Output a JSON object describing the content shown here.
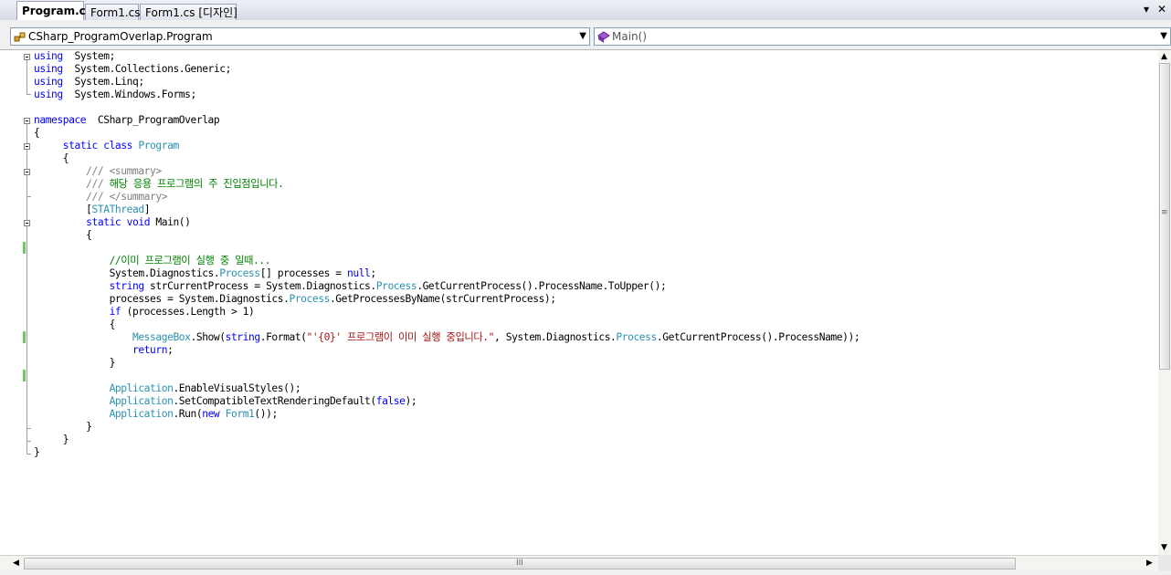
{
  "tabs": [
    {
      "label": "Program.cs",
      "active": true
    },
    {
      "label": "Form1.cs",
      "active": false
    },
    {
      "label": "Form1.cs [디자인]",
      "active": false
    }
  ],
  "tab_controls": {
    "dropdown_glyph": "▾",
    "close_glyph": "✕"
  },
  "nav": {
    "class_combo": {
      "value": "CSharp_ProgramOverlap.Program",
      "icon": "class-icon"
    },
    "member_combo": {
      "value": "Main()",
      "icon": "method-icon"
    },
    "dropdown_glyph": "▼"
  },
  "code_lines": [
    [
      [
        "kw",
        "using"
      ],
      [
        "",
        "  System;"
      ]
    ],
    [
      [
        "kw",
        "using"
      ],
      [
        "",
        "  System.Collections.Generic;"
      ]
    ],
    [
      [
        "kw",
        "using"
      ],
      [
        "",
        "  System.Linq;"
      ]
    ],
    [
      [
        "kw",
        "using"
      ],
      [
        "",
        "  System.Windows.Forms;"
      ]
    ],
    [],
    [
      [
        "kw",
        "namespace"
      ],
      [
        "",
        "  CSharp_ProgramOverlap"
      ]
    ],
    [
      [
        "",
        "{"
      ]
    ],
    [
      [
        "",
        "     "
      ],
      [
        "kw",
        "static"
      ],
      [
        "",
        " "
      ],
      [
        "kw",
        "class"
      ],
      [
        "",
        " "
      ],
      [
        "ty",
        "Program"
      ]
    ],
    [
      [
        "",
        "     {"
      ]
    ],
    [
      [
        "",
        "         "
      ],
      [
        "dc",
        "/// <summary>"
      ]
    ],
    [
      [
        "",
        "         "
      ],
      [
        "dc",
        "/// "
      ],
      [
        "cm",
        "해당 응용 프로그램의 주 진입점입니다."
      ]
    ],
    [
      [
        "",
        "         "
      ],
      [
        "dc",
        "/// </summary>"
      ]
    ],
    [
      [
        "",
        "         ["
      ],
      [
        "ty",
        "STAThread"
      ],
      [
        "",
        "]"
      ]
    ],
    [
      [
        "",
        "         "
      ],
      [
        "kw",
        "static"
      ],
      [
        "",
        " "
      ],
      [
        "kw",
        "void"
      ],
      [
        "",
        " Main()"
      ]
    ],
    [
      [
        "",
        "         {"
      ]
    ],
    [],
    [
      [
        "",
        "             "
      ],
      [
        "cm",
        "//이미 프로그램이 실행 중 일때..."
      ]
    ],
    [
      [
        "",
        "             System.Diagnostics."
      ],
      [
        "ty",
        "Process"
      ],
      [
        "",
        "[] processes = "
      ],
      [
        "kw",
        "null"
      ],
      [
        "",
        ";"
      ]
    ],
    [
      [
        "",
        "             "
      ],
      [
        "kw",
        "string"
      ],
      [
        "",
        " strCurrentProcess = System.Diagnostics."
      ],
      [
        "ty",
        "Process"
      ],
      [
        "",
        ".GetCurrentProcess().ProcessName.ToUpper();"
      ]
    ],
    [
      [
        "",
        "             processes = System.Diagnostics."
      ],
      [
        "ty",
        "Process"
      ],
      [
        "",
        ".GetProcessesByName(strCurrentProcess);"
      ]
    ],
    [
      [
        "",
        "             "
      ],
      [
        "kw",
        "if"
      ],
      [
        "",
        " (processes.Length > 1)"
      ]
    ],
    [
      [
        "",
        "             {"
      ]
    ],
    [
      [
        "",
        "                 "
      ],
      [
        "ty",
        "MessageBox"
      ],
      [
        "",
        ".Show("
      ],
      [
        "kw",
        "string"
      ],
      [
        "",
        ".Format("
      ],
      [
        "st",
        "\"'{0}' 프로그램이 이미 실행 중입니다.\""
      ],
      [
        "",
        ", System.Diagnostics."
      ],
      [
        "ty",
        "Process"
      ],
      [
        "",
        ".GetCurrentProcess().ProcessName));"
      ]
    ],
    [
      [
        "",
        "                 "
      ],
      [
        "kw",
        "return"
      ],
      [
        "",
        ";"
      ]
    ],
    [
      [
        "",
        "             }"
      ]
    ],
    [],
    [
      [
        "",
        "             "
      ],
      [
        "ty",
        "Application"
      ],
      [
        "",
        ".EnableVisualStyles();"
      ]
    ],
    [
      [
        "",
        "             "
      ],
      [
        "ty",
        "Application"
      ],
      [
        "",
        ".SetCompatibleTextRenderingDefault("
      ],
      [
        "kw",
        "false"
      ],
      [
        "",
        ");"
      ]
    ],
    [
      [
        "",
        "             "
      ],
      [
        "ty",
        "Application"
      ],
      [
        "",
        ".Run("
      ],
      [
        "kw",
        "new"
      ],
      [
        "",
        " "
      ],
      [
        "ty",
        "Form1"
      ],
      [
        "",
        "());"
      ]
    ],
    [
      [
        "",
        "         }"
      ]
    ],
    [
      [
        "",
        "     }"
      ]
    ],
    [
      [
        "",
        "}"
      ]
    ]
  ],
  "scrollbar": {
    "grip_glyph": "≡",
    "hgrip_glyph": "III",
    "up": "▲",
    "down": "▼",
    "left": "◀",
    "right": "▶"
  }
}
